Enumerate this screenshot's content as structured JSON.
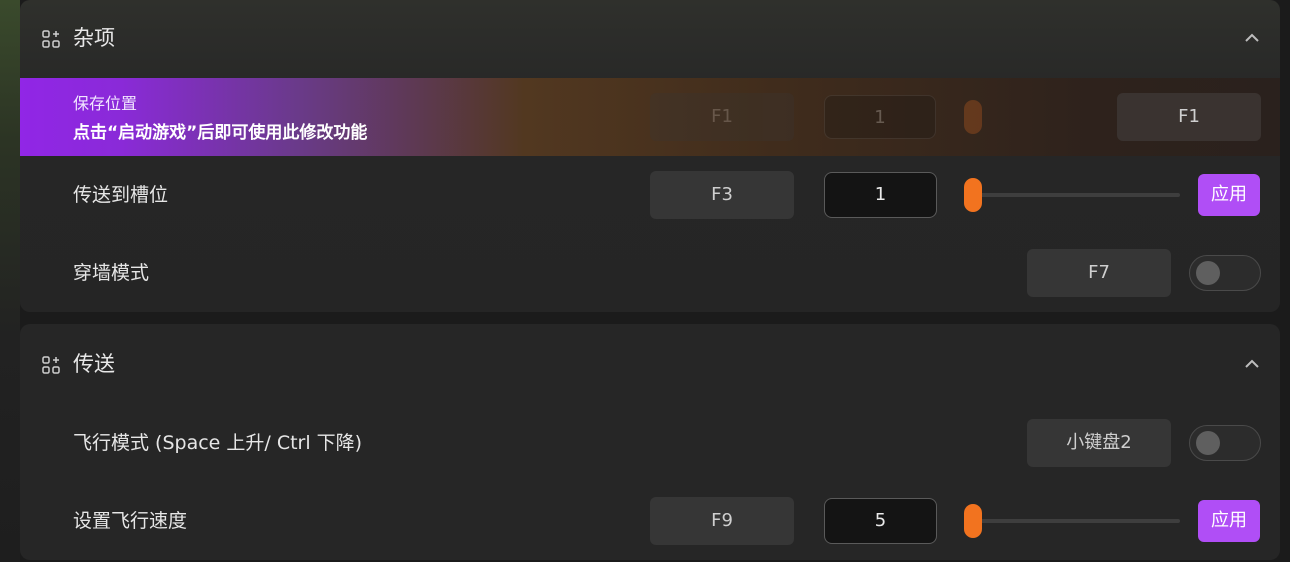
{
  "colors": {
    "accent_purple": "#b04ef6",
    "slider_orange": "#f2731f",
    "highlight_start": "#9126e6"
  },
  "misc_section": {
    "title": "杂项",
    "icon": "apps-add-icon",
    "collapse_icon": "chevron-up-icon",
    "save_position": {
      "label": "保存位置",
      "notice": "点击“启动游戏”后即可使用此修改功能",
      "hotkey_dim": "F1",
      "number_dim": "1",
      "hotkey": "F1"
    },
    "teleport_slot": {
      "label": "传送到槽位",
      "hotkey": "F3",
      "value": "1",
      "slider_fraction": 0,
      "apply_label": "应用"
    },
    "noclip": {
      "label": "穿墙模式",
      "hotkey": "F7",
      "enabled": false
    }
  },
  "teleport_section": {
    "title": "传送",
    "icon": "apps-add-icon",
    "collapse_icon": "chevron-up-icon",
    "fly_mode": {
      "label": "飞行模式 (Space 上升/ Ctrl 下降)",
      "hotkey": "小键盘2",
      "enabled": false
    },
    "fly_speed": {
      "label": "设置飞行速度",
      "hotkey": "F9",
      "value": "5",
      "slider_fraction": 0,
      "apply_label": "应用"
    }
  }
}
